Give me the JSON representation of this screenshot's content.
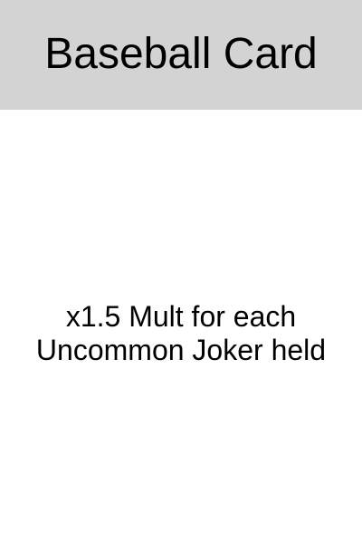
{
  "card": {
    "title": "Baseball Card",
    "description_lines": [
      "x1.5 Mult for each",
      "Uncommon Joker held"
    ],
    "colors": {
      "header_background": "#d3d3d3",
      "body_background": "#ffffff",
      "text": "#000000"
    }
  }
}
